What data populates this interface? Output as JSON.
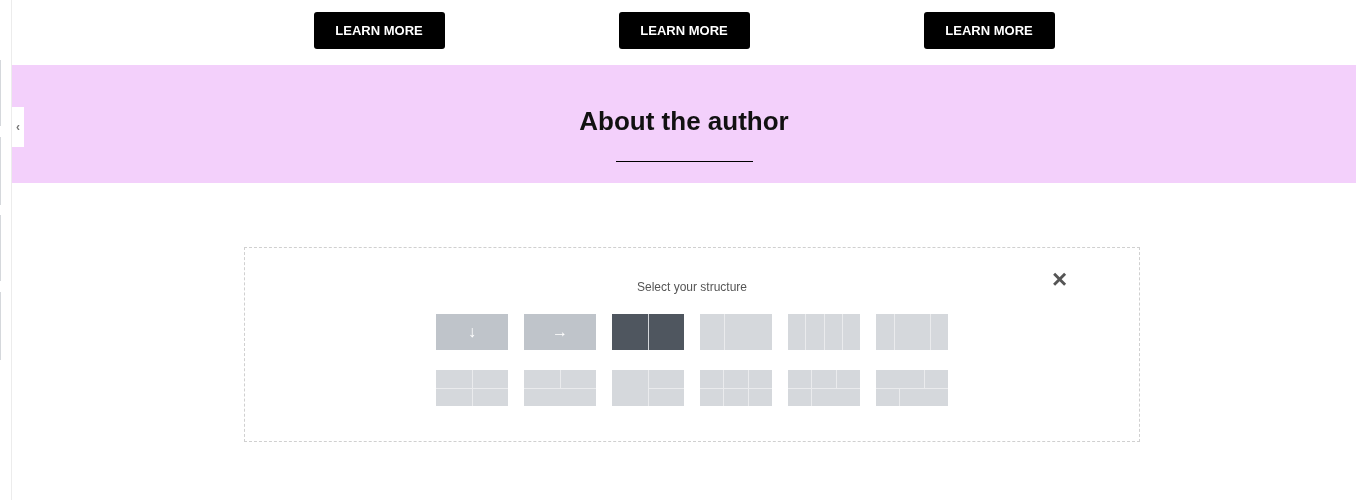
{
  "buttons": [
    {
      "label": "LEARN MORE"
    },
    {
      "label": "LEARN MORE"
    },
    {
      "label": "LEARN MORE"
    }
  ],
  "collapse_toggle": {
    "glyph": "‹"
  },
  "section": {
    "title": "About the author"
  },
  "structure_picker": {
    "title": "Select your structure",
    "close": "×",
    "structures": [
      {
        "kind": "arrow",
        "glyph": "↓",
        "selected": false
      },
      {
        "kind": "arrow",
        "glyph": "→",
        "selected": false
      },
      {
        "kind": "cols-50-50",
        "selected": true
      },
      {
        "kind": "cols-33-67",
        "selected": false
      },
      {
        "kind": "cols-25x4",
        "selected": false
      },
      {
        "kind": "cols-25-50-25",
        "selected": false
      },
      {
        "kind": "grid-2x2",
        "selected": false
      },
      {
        "kind": "top2-bottom1",
        "selected": false
      },
      {
        "kind": "left1-right2",
        "selected": false
      },
      {
        "kind": "grid-3x2",
        "selected": false
      },
      {
        "kind": "top3-bottom-33-67",
        "selected": false
      },
      {
        "kind": "top-67-33-bottom-33-67",
        "selected": false
      }
    ]
  }
}
